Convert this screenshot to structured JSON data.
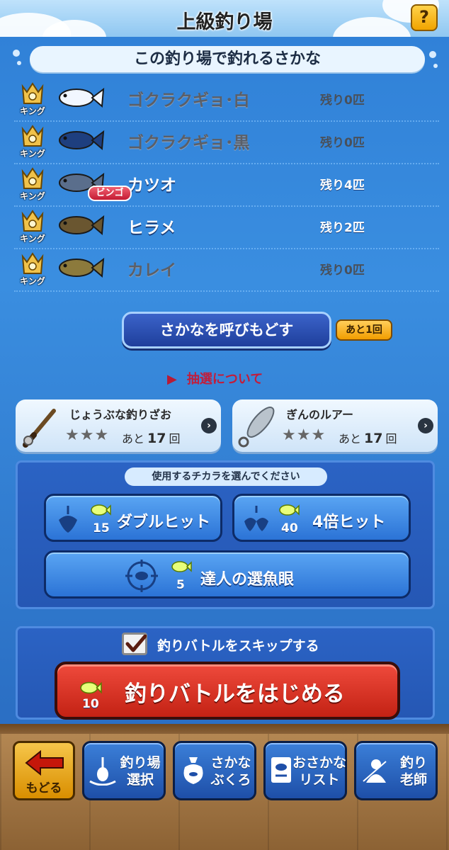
{
  "header": {
    "title": "上級釣り場",
    "help_label": "?"
  },
  "fish_list": {
    "title": "この釣り場で釣れるさかな",
    "items": [
      {
        "badge": "キング",
        "name": "ゴクラクギョ･白",
        "remaining": "残り0匹",
        "status": "done",
        "color": "#f2f7ff"
      },
      {
        "badge": "キング",
        "name": "ゴクラクギョ･黒",
        "remaining": "残り0匹",
        "status": "done",
        "color": "#1e3f7f"
      },
      {
        "badge": "キング",
        "name": "カツオ",
        "remaining": "残り4匹",
        "status": "live",
        "color": "#5a6e8c",
        "tag": "ビンゴ"
      },
      {
        "badge": "キング",
        "name": "ヒラメ",
        "remaining": "残り2匹",
        "status": "live",
        "color": "#6a5630"
      },
      {
        "badge": "キング",
        "name": "カレイ",
        "remaining": "残り0匹",
        "status": "done",
        "color": "#8c7a3c"
      }
    ]
  },
  "recall": {
    "label": "さかなを呼びもどす",
    "remaining_badge": "あと1回"
  },
  "lottery_link": "抽選について",
  "equipment": [
    {
      "name": "じょうぶな釣りざお",
      "stars": "★★★",
      "prefix": "あと",
      "count": "17",
      "unit": "回",
      "icon": "fishing-rod-icon"
    },
    {
      "name": "ぎんのルアー",
      "stars": "★★★",
      "prefix": "あと",
      "count": "17",
      "unit": "回",
      "icon": "silver-lure-icon"
    }
  ],
  "powers": {
    "caption": "使用するチカラを選んでください",
    "double_hit": {
      "label": "ダブルヒット",
      "cost": "15"
    },
    "quad_hit": {
      "label": "4倍ヒット",
      "cost": "40"
    },
    "expert_eye": {
      "label": "達人の選魚眼",
      "cost": "5"
    }
  },
  "start": {
    "skip_label": "釣りバトルをスキップする",
    "skip_checked": true,
    "start_label": "釣りバトルをはじめる",
    "cost": "10"
  },
  "bottom_nav": {
    "back": "もどる",
    "items": [
      {
        "line1": "釣り場",
        "line2": "選択",
        "icon": "fishing-spot-icon"
      },
      {
        "line1": "さかな",
        "line2": "ぶくろ",
        "icon": "fish-bag-icon"
      },
      {
        "line1": "おさかな",
        "line2": "リスト",
        "icon": "fish-list-icon"
      },
      {
        "line1": "釣り",
        "line2": "老師",
        "icon": "fishing-master-icon"
      }
    ]
  },
  "colors": {
    "accent_red": "#d3291b",
    "panel_blue": "#2b63c4",
    "gold": "#f0a400"
  }
}
